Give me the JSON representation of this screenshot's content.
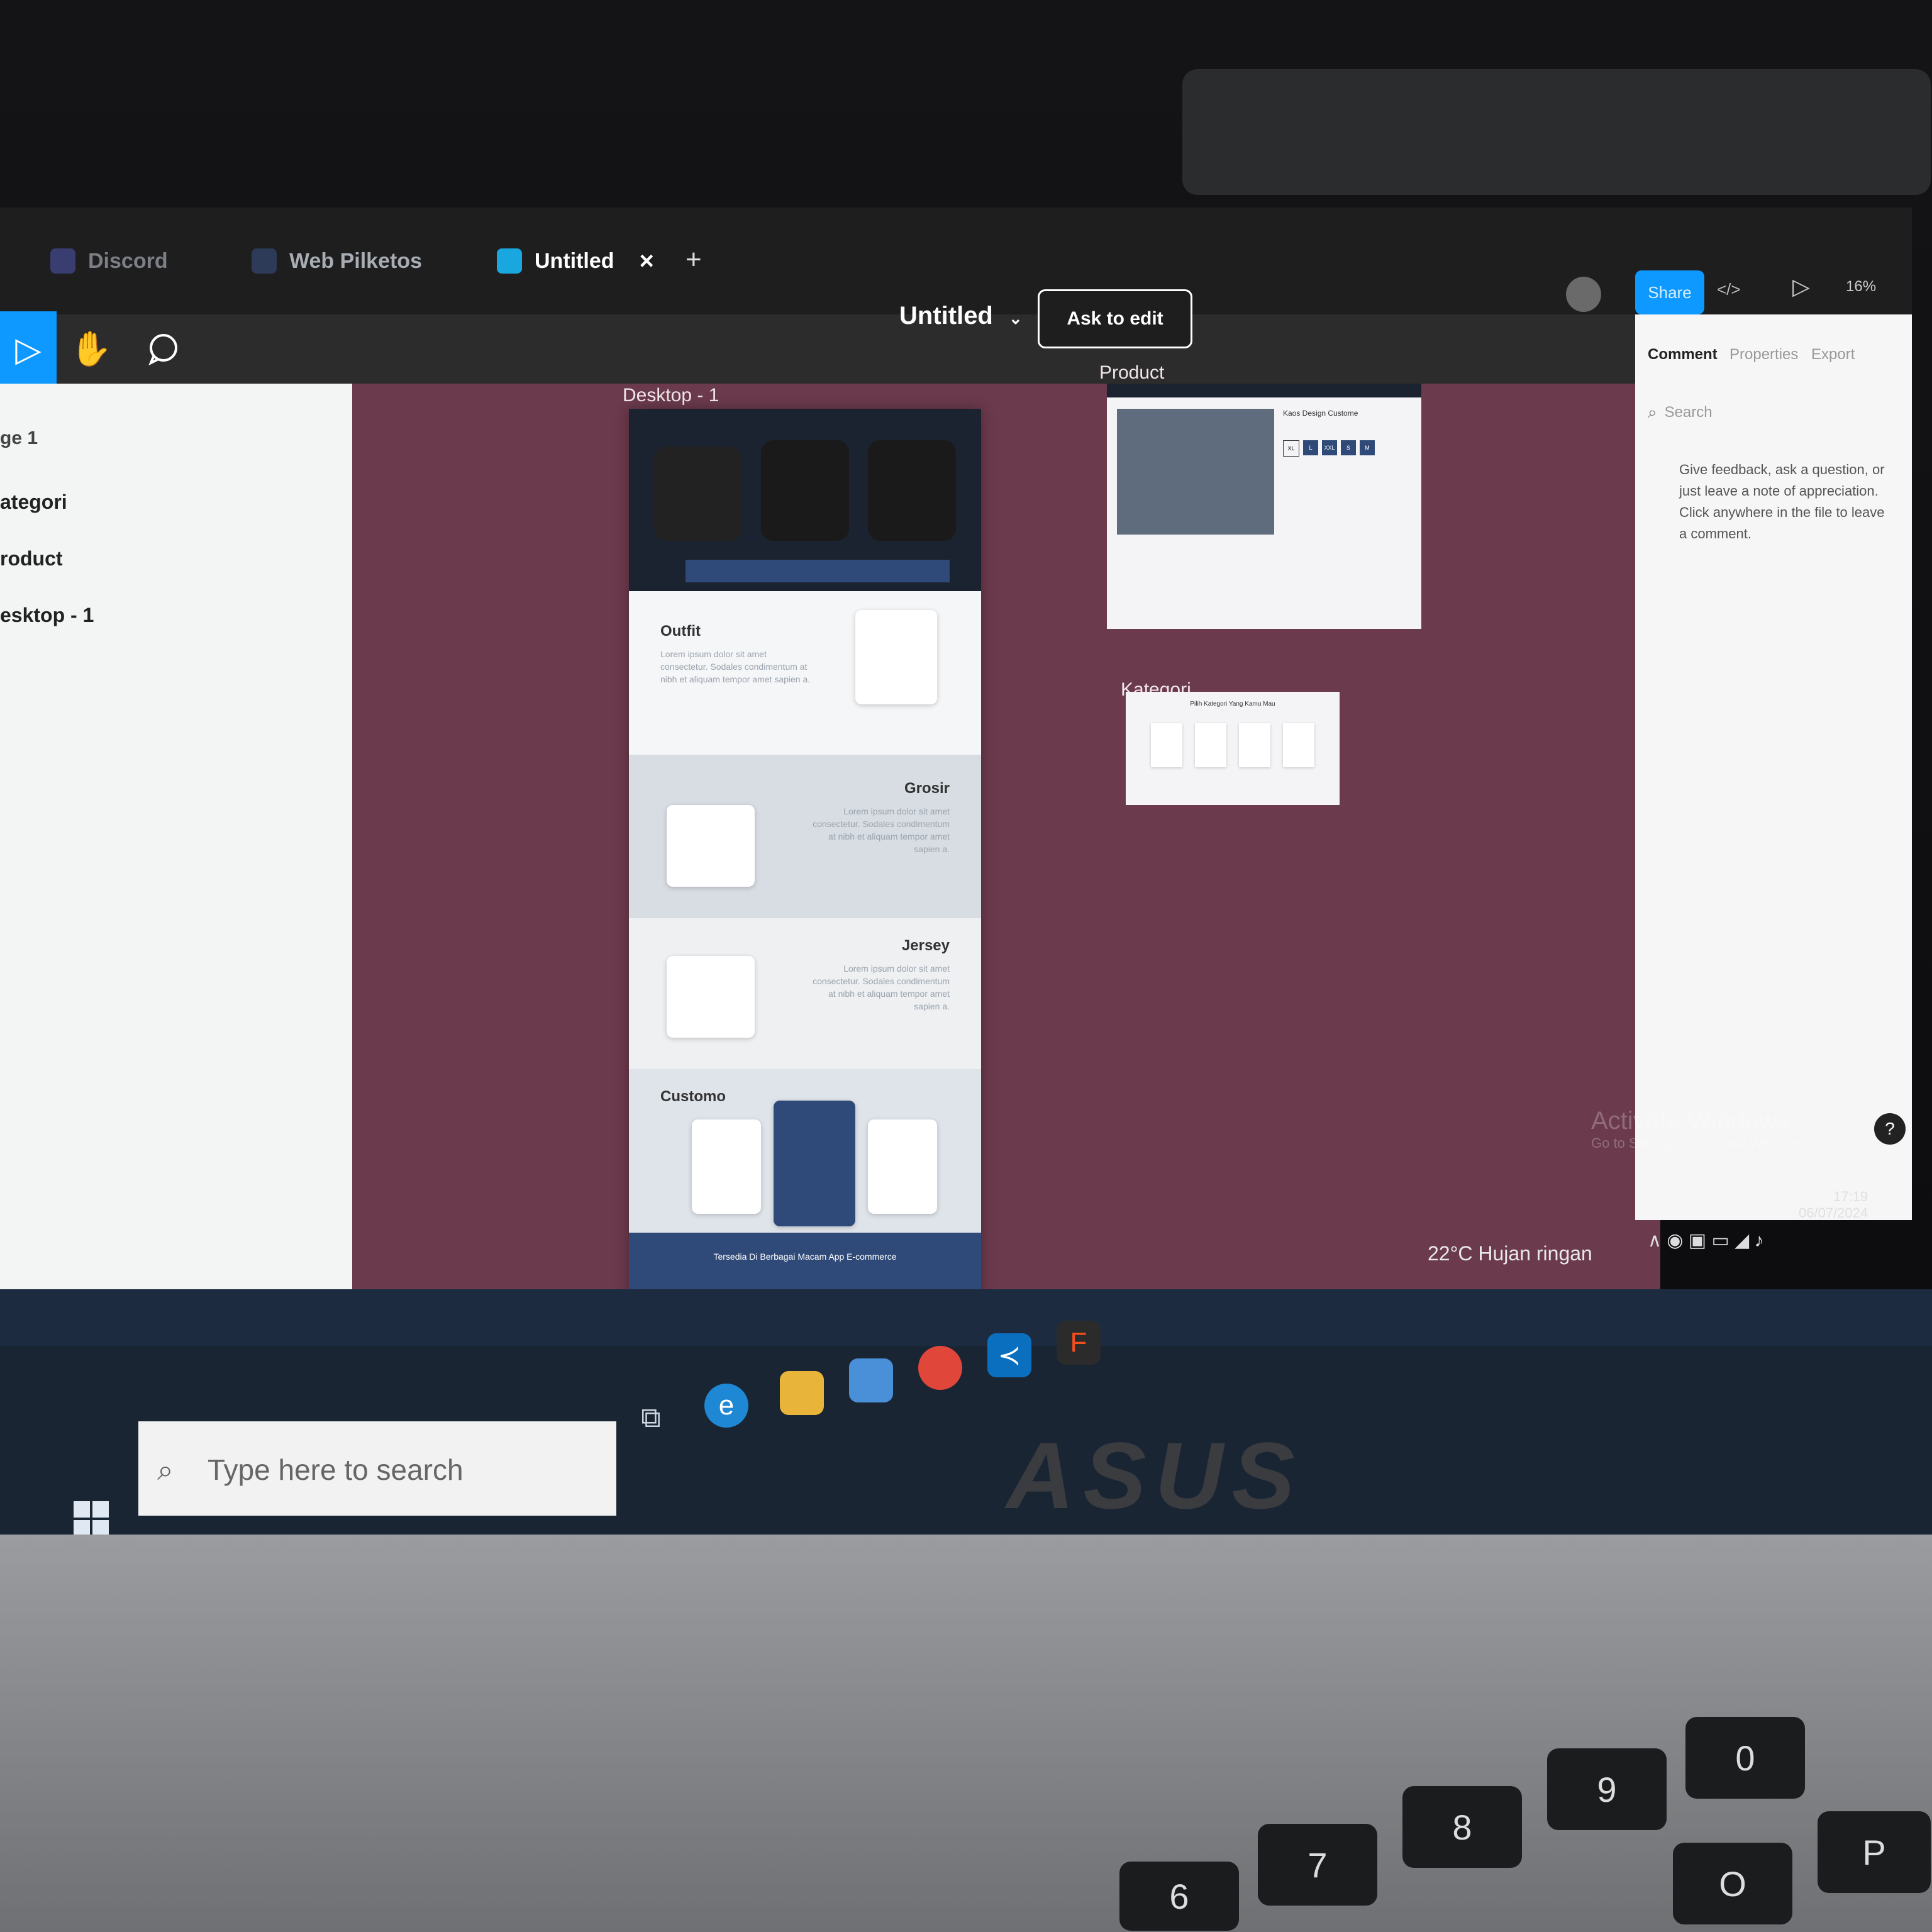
{
  "browser": {
    "tabs": [
      {
        "label": "Discord",
        "active": false
      },
      {
        "label": "Web Pilketos",
        "active": false
      },
      {
        "label": "Untitled",
        "active": true
      }
    ],
    "new_tab": "+",
    "close_tab": "×"
  },
  "editor": {
    "file_title": "Untitled",
    "ask_to_edit": "Ask to edit",
    "share": "Share",
    "zoom": "16%",
    "code_icon": "</>"
  },
  "layers": {
    "page": "ge 1",
    "items": [
      "ategori",
      "roduct",
      "esktop - 1"
    ]
  },
  "canvas": {
    "frames": {
      "desktop1": "Desktop - 1",
      "product": "Product",
      "kategori": "Kategori"
    },
    "desktop1": {
      "sections": [
        "Outfit",
        "Grosir",
        "Jersey",
        "Customo"
      ],
      "lorem": "Lorem ipsum dolor sit amet consectetur. Sodales condimentum at nibh et aliquam tempor amet sapien a.",
      "footer": "Tersedia Di Berbagai Macam App E-commerce"
    },
    "product": {
      "title": "Kaos Design Custome",
      "sizes": [
        "XL",
        "L",
        "XXL",
        "S",
        "M"
      ]
    },
    "kategori": {
      "title": "Pilih Kategori Yang Kamu Mau"
    }
  },
  "right_panel": {
    "tabs": [
      "Comment",
      "Properties",
      "Export"
    ],
    "search_placeholder": "Search",
    "hint": "Give feedback, ask a question, or just leave a note of appreciation. Click anywhere in the file to leave a comment."
  },
  "os": {
    "activate_title": "Activate Windows",
    "activate_sub": "Go to Settings to activate Windows.",
    "search_placeholder": "Type here to search",
    "weather": "22°C  Hujan ringan",
    "time": "17:19",
    "date": "06/07/2024",
    "help": "?"
  },
  "hardware": {
    "brand": "ASUS",
    "keys": [
      "9",
      "0",
      "8",
      "7",
      "6",
      "P",
      "O"
    ]
  },
  "colors": {
    "canvas_bg": "#6b3a4c",
    "share_blue": "#0d99ff",
    "figma_toolbar": "#2c2c2c"
  }
}
